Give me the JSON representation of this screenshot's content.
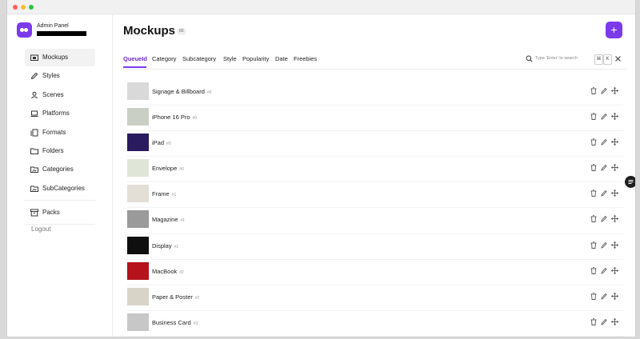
{
  "app": {
    "title": "Admin Panel"
  },
  "sidebar": {
    "items": [
      {
        "label": "Mockups",
        "icon": "mockup-icon",
        "active": true
      },
      {
        "label": "Styles",
        "icon": "pen-icon"
      },
      {
        "label": "Scenes",
        "icon": "user-icon"
      },
      {
        "label": "Platforms",
        "icon": "laptop-icon"
      },
      {
        "label": "Formats",
        "icon": "layers-icon"
      },
      {
        "label": "Folders",
        "icon": "folder-icon"
      },
      {
        "label": "Categories",
        "icon": "folder-image-icon"
      },
      {
        "label": "SubCategories",
        "icon": "folder-image-icon"
      },
      {
        "label": "Packs",
        "icon": "archive-icon"
      }
    ],
    "logout_label": "Logout"
  },
  "header": {
    "title": "Mockups",
    "count": "60",
    "add_label": "+"
  },
  "tabs": [
    {
      "label": "QueueId",
      "active": true
    },
    {
      "label": "Category"
    },
    {
      "label": "Subcategory"
    },
    {
      "label": "Style"
    },
    {
      "label": "Popularity"
    },
    {
      "label": "Date"
    },
    {
      "label": "Freebies"
    }
  ],
  "search": {
    "placeholder": "Type 'Enter' to search",
    "kbd_modifier": "⌘",
    "kbd_key": "K"
  },
  "rows": [
    {
      "name": "Signage & Billboard",
      "queue_id": "#0",
      "thumb_color": "#d9d9d9"
    },
    {
      "name": "iPhone 16 Pro",
      "queue_id": "#0",
      "thumb_color": "#c9cfc4"
    },
    {
      "name": "iPad",
      "queue_id": "#0",
      "thumb_color": "#2a1a5e"
    },
    {
      "name": "Envelope",
      "queue_id": "#0",
      "thumb_color": "#dfe6d8"
    },
    {
      "name": "Frame",
      "queue_id": "#1",
      "thumb_color": "#e3dfd6"
    },
    {
      "name": "Magazine",
      "queue_id": "#1",
      "thumb_color": "#9a9a9a"
    },
    {
      "name": "Display",
      "queue_id": "#1",
      "thumb_color": "#0f0f0f"
    },
    {
      "name": "MacBook",
      "queue_id": "#2",
      "thumb_color": "#b5121b"
    },
    {
      "name": "Paper & Poster",
      "queue_id": "#2",
      "thumb_color": "#d8d4c8"
    },
    {
      "name": "Business Card",
      "queue_id": "#3",
      "thumb_color": "#c7c7c7"
    }
  ],
  "colors": {
    "accent": "#7c3aed"
  }
}
